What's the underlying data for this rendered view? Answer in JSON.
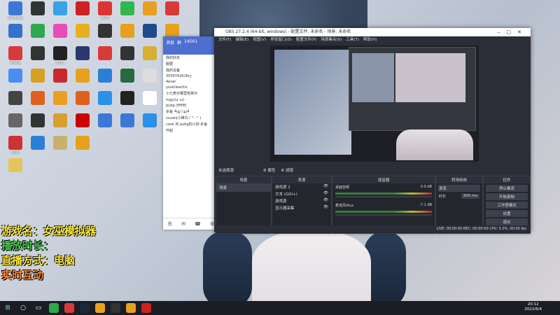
{
  "desktop": {
    "icons": [
      {
        "label": "Windows",
        "color": "#3a78d8"
      },
      {
        "label": "",
        "color": "#3572c9"
      },
      {
        "label": "网易云",
        "color": "#d83a3a"
      },
      {
        "label": "",
        "color": "#4a8df0"
      },
      {
        "label": "",
        "color": "#444"
      },
      {
        "label": "",
        "color": "#666"
      },
      {
        "label": "Apex",
        "color": "#c33"
      },
      {
        "label": "",
        "color": "#e5c55a"
      },
      {
        "label": "",
        "color": "#333"
      },
      {
        "label": "",
        "color": "#2fa84e"
      },
      {
        "label": "",
        "color": "#333"
      },
      {
        "label": "",
        "color": "#d8a020"
      },
      {
        "label": "",
        "color": "#e06020"
      },
      {
        "label": "",
        "color": "#333"
      },
      {
        "label": "",
        "color": "#2a80d8"
      },
      {
        "label": "",
        "color": "#3aa0e8"
      },
      {
        "label": "",
        "color": "#e84cb8"
      },
      {
        "label": "EPIC",
        "color": "#222"
      },
      {
        "label": "",
        "color": "#c82a2a"
      },
      {
        "label": "",
        "color": "#e8a020"
      },
      {
        "label": "",
        "color": "#d8a030"
      },
      {
        "label": "",
        "color": "#c8b070"
      },
      {
        "label": "",
        "color": "#c22"
      },
      {
        "label": "",
        "color": "#e8b020"
      },
      {
        "label": "",
        "color": "#2a3870"
      },
      {
        "label": "",
        "color": "#e8a020"
      },
      {
        "label": "",
        "color": "#e06020"
      },
      {
        "label": "",
        "color": "#c00"
      },
      {
        "label": "",
        "color": "#e8a020"
      },
      {
        "label": "WPS",
        "color": "#d33"
      },
      {
        "label": "",
        "color": "#333"
      },
      {
        "label": "",
        "color": "#d83a3a"
      },
      {
        "label": "",
        "color": "#2a80d8"
      },
      {
        "label": "",
        "color": "#2a90e8"
      },
      {
        "label": "",
        "color": "#3a78d8"
      },
      {
        "label": "",
        "color": "#2fb84e"
      },
      {
        "label": "",
        "color": "#e8a020"
      },
      {
        "label": "",
        "color": "#333"
      },
      {
        "label": "",
        "color": "#2a6840"
      },
      {
        "label": "",
        "color": "#222"
      },
      {
        "label": "",
        "color": "#3a78d8"
      },
      {
        "label": "",
        "color": "#e8a020"
      },
      {
        "label": "",
        "color": "#1e4a8a"
      },
      {
        "label": "",
        "color": "#d8b030"
      },
      {
        "label": "",
        "color": "#ddd"
      },
      {
        "label": "",
        "color": "#fff"
      },
      {
        "label": "",
        "color": "#2a90e8"
      },
      {
        "label": "",
        "color": "#d83a3a"
      },
      {
        "label": "",
        "color": "#e8a020"
      },
      {
        "label": "",
        "color": "#2a80d8"
      },
      {
        "label": "",
        "color": "#c33"
      },
      {
        "label": "",
        "color": "#e8b020"
      }
    ]
  },
  "overlay": {
    "lines": [
      {
        "text": "游戏名：女巫模拟器",
        "color": "#ffeb3b"
      },
      {
        "text": "播放时长：",
        "color": "#4ac850"
      },
      {
        "text": "直播方式：电脑",
        "color": "#ffeb3b"
      },
      {
        "text": "实时互动",
        "color": "#ff8a3a"
      }
    ]
  },
  "qq": {
    "tabs": [
      "消息",
      "群",
      "14561"
    ],
    "rows": [
      "我的好友",
      "概要",
      "我的设备",
      "3559742616ry",
      "4ever",
      "youkilearths",
      "小七表示哪里啦家伙",
      "rugy(ω･ω)",
      "pubg (Θ∀Θ)",
      "杀鱼 ┗(≧▽≦)┛",
      "suuanj小蜂鸟 ( ° - ° )",
      "cook 鸡 pubg的小刻 杀鱼",
      "开船"
    ],
    "bottom": [
      "☰",
      "✉",
      "☎",
      "⚙"
    ]
  },
  "obs": {
    "title": "OBS 27.2.4 (64-bit, windows) - 配置文件: 未命名 - 场景: 未命名",
    "menu": [
      "文件(F)",
      "编辑(E)",
      "视图(V)",
      "停靠窗口(D)",
      "配置文件(P)",
      "场景集合(S)",
      "工具(T)",
      "帮助(H)"
    ],
    "toolbar_label": "未选择源",
    "toolbar_props": "属性",
    "toolbar_filter": "滤镜",
    "docks": {
      "scenes": {
        "title": "场景",
        "items": [
          "场景"
        ]
      },
      "sources": {
        "title": "来源",
        "items": [
          "游戏源 2",
          "文本 (GDI+)",
          "游戏源",
          "显示器采集"
        ]
      },
      "mixer": {
        "title": "混音器",
        "channels": [
          {
            "name": "桌面音频",
            "db": "0.0 dB"
          },
          {
            "name": "麦克风/Aux",
            "db": "-7.1 dB"
          }
        ]
      },
      "transitions": {
        "title": "转场特效",
        "type": "渐变",
        "duration_label": "时长",
        "duration": "300 ms"
      },
      "controls": {
        "title": "控件",
        "buttons": [
          "停止推流",
          "开始录制",
          "工作室模式",
          "设置",
          "退出"
        ]
      }
    },
    "status": "LIVE: 00:00:00   REC: 00:00:00   CPU: 5.0%, 60.00 fps"
  },
  "taskbar": {
    "time": "20:12",
    "date": "2022/6/4"
  }
}
